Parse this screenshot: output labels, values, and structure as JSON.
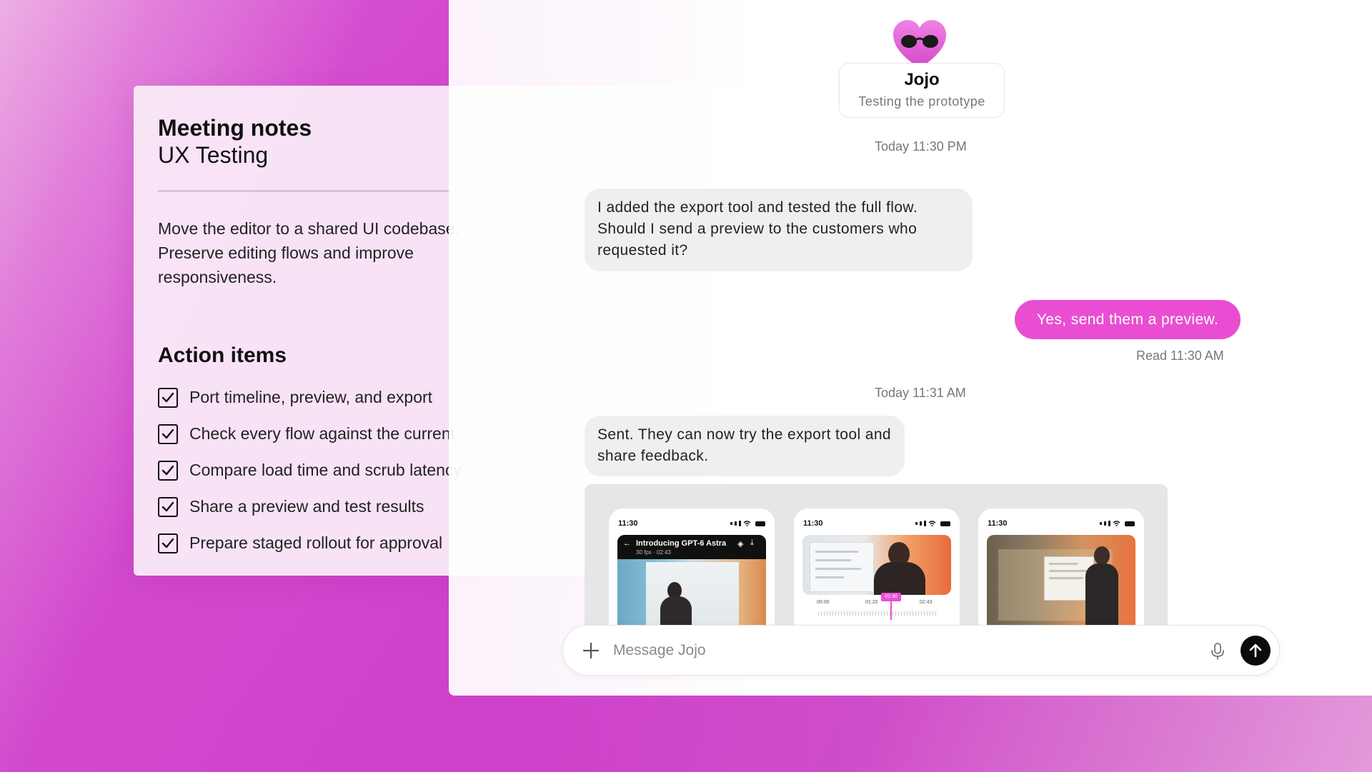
{
  "notes": {
    "title": "Meeting notes",
    "subtitle": "UX Testing",
    "body": "Move the editor to a shared UI codebase. Preserve editing flows and improve responsiveness.",
    "action_title": "Action items",
    "action_items": [
      {
        "label": "Port timeline, preview, and export",
        "checked": true
      },
      {
        "label": "Check every flow against the current",
        "checked": true
      },
      {
        "label": "Compare load time and scrub latency",
        "checked": true
      },
      {
        "label": "Share a preview and test results",
        "checked": true
      },
      {
        "label": "Prepare staged rollout for approval",
        "checked": true
      }
    ]
  },
  "chat": {
    "contact": {
      "name": "Jojo",
      "status": "Testing the prototype",
      "avatar_icon": "heart-sunglasses-icon"
    },
    "messages": {
      "timestamp_1": "Today 11:30 PM",
      "incoming_1": "I added the export tool and tested the full flow. Should I send a preview to the customers who requested it?",
      "outgoing_1": "Yes, send them a preview.",
      "read_receipt": "Read 11:30 AM",
      "timestamp_2": "Today 11:31 AM",
      "incoming_2": "Sent. They can now try the export tool and share feedback."
    },
    "previews": [
      {
        "time": "11:30",
        "title": "Introducing GPT-6 Astra",
        "meta": "30 fps · 02:43"
      },
      {
        "time": "11:30",
        "timeline_start": "00:00",
        "timeline_mid": "01:20",
        "timeline_end": "02:43",
        "marker": "01:30"
      },
      {
        "time": "11:30"
      }
    ],
    "composer": {
      "placeholder": "Message Jojo",
      "value": ""
    }
  },
  "colors": {
    "accent": "#e94ed2",
    "background_magenta": "#cf42cb",
    "send_button": "#0b0b0b"
  }
}
